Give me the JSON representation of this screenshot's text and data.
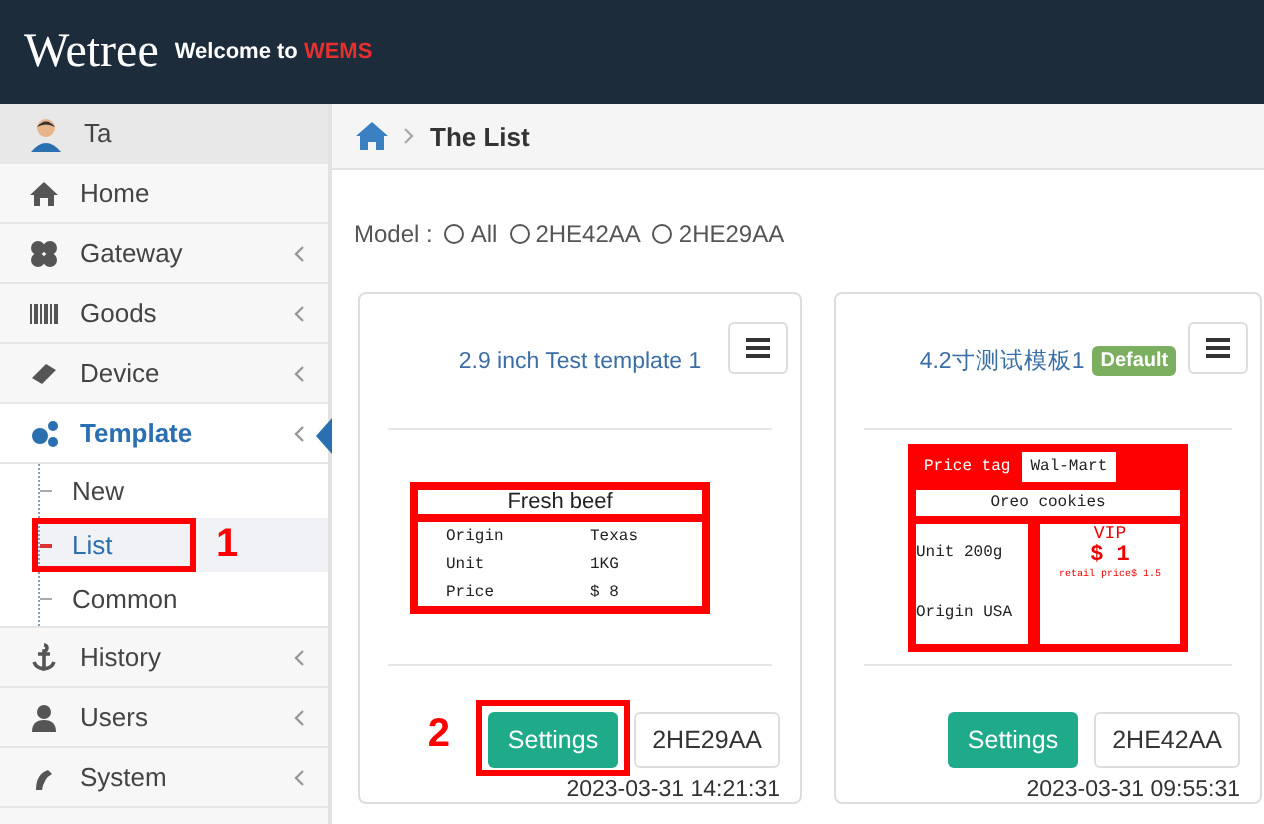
{
  "header": {
    "logo": "Wetree",
    "welcome": "Welcome to ",
    "brand": "WEMS"
  },
  "sidebar": {
    "user": "Ta",
    "items": [
      {
        "label": "Home",
        "has_arrow": false,
        "expanded": false
      },
      {
        "label": "Gateway",
        "has_arrow": true,
        "expanded": false
      },
      {
        "label": "Goods",
        "has_arrow": true,
        "expanded": false
      },
      {
        "label": "Device",
        "has_arrow": true,
        "expanded": false
      },
      {
        "label": "Template",
        "has_arrow": true,
        "expanded": true,
        "children": [
          {
            "label": "New",
            "selected": false
          },
          {
            "label": "List",
            "selected": true,
            "callout": "1"
          },
          {
            "label": "Common",
            "selected": false
          }
        ]
      },
      {
        "label": "History",
        "has_arrow": true,
        "expanded": false
      },
      {
        "label": "Users",
        "has_arrow": true,
        "expanded": false
      },
      {
        "label": "System",
        "has_arrow": true,
        "expanded": false
      }
    ]
  },
  "breadcrumb": {
    "current": "The List"
  },
  "filter": {
    "label": "Model :",
    "options": [
      {
        "label": "All",
        "selected": false
      },
      {
        "label": "2HE42AA",
        "selected": false
      },
      {
        "label": "2HE29AA",
        "selected": false
      }
    ]
  },
  "cards": [
    {
      "title": "2.9 inch Test template 1",
      "kind": "simple",
      "callout": "2",
      "preview": {
        "heading": "Fresh beef",
        "rows": [
          [
            "Origin",
            "Texas"
          ],
          [
            "Unit",
            "1KG"
          ],
          [
            "Price",
            "$ 8"
          ]
        ]
      },
      "settings": "Settings",
      "model": "2HE29AA",
      "date": "2023-03-31 14:21:31"
    },
    {
      "title": "4.2寸测试模板1",
      "badge": "Default",
      "kind": "pricetag",
      "preview": {
        "tag": "Price tag",
        "store": "Wal-Mart",
        "product": "Oreo cookies",
        "unit": "Unit  200g",
        "origin": "Origin USA",
        "vip": "VIP",
        "price": "$ 1",
        "retail": "retail price$ 1.5"
      },
      "settings": "Settings",
      "model": "2HE42AA",
      "date": "2023-03-31 09:55:31"
    }
  ]
}
